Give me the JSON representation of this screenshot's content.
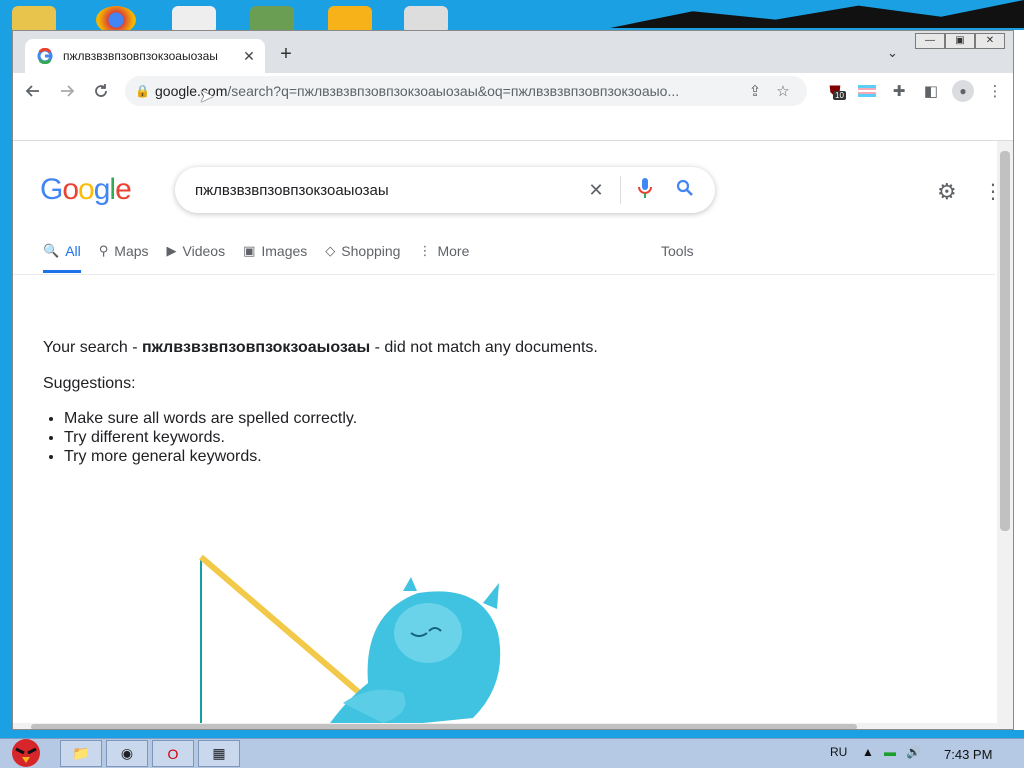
{
  "browser": {
    "tab_title": "пжлвзвзвпзовпзокзоаыозаы",
    "new_tab_symbol": "+",
    "url_domain": "google.com",
    "url_path": "/search?q=пжлвзвзвпзовпзокзоаыозаы&oq=пжлвзвзвпзовпзокзоаыо...",
    "extension_badge": "10"
  },
  "google": {
    "logo_letters": [
      "G",
      "o",
      "o",
      "g",
      "l",
      "e"
    ],
    "logo_colors": [
      "#4285F4",
      "#EA4335",
      "#FBBC05",
      "#4285F4",
      "#34A853",
      "#EA4335"
    ],
    "search_value": "пжлвзвзвпзовпзокзоаыозаы",
    "tabs": [
      {
        "label": "All",
        "icon": "search-icon",
        "active": true
      },
      {
        "label": "Maps",
        "icon": "map-pin-icon",
        "active": false
      },
      {
        "label": "Videos",
        "icon": "play-icon",
        "active": false
      },
      {
        "label": "Images",
        "icon": "image-icon",
        "active": false
      },
      {
        "label": "Shopping",
        "icon": "tag-icon",
        "active": false
      },
      {
        "label": "More",
        "icon": "more-vert-icon",
        "active": false
      }
    ],
    "tools_label": "Tools",
    "noresult": {
      "prefix": "Your search - ",
      "query": "пжлвзвзвпзовпзокзоаыозаы",
      "suffix": " - did not match any documents."
    },
    "suggestions_title": "Suggestions:",
    "suggestions": [
      "Make sure all words are spelled correctly.",
      "Try different keywords.",
      "Try more general keywords."
    ],
    "accent": "#1a73e8"
  },
  "taskbar": {
    "language": "RU",
    "time": "7:43 PM"
  }
}
